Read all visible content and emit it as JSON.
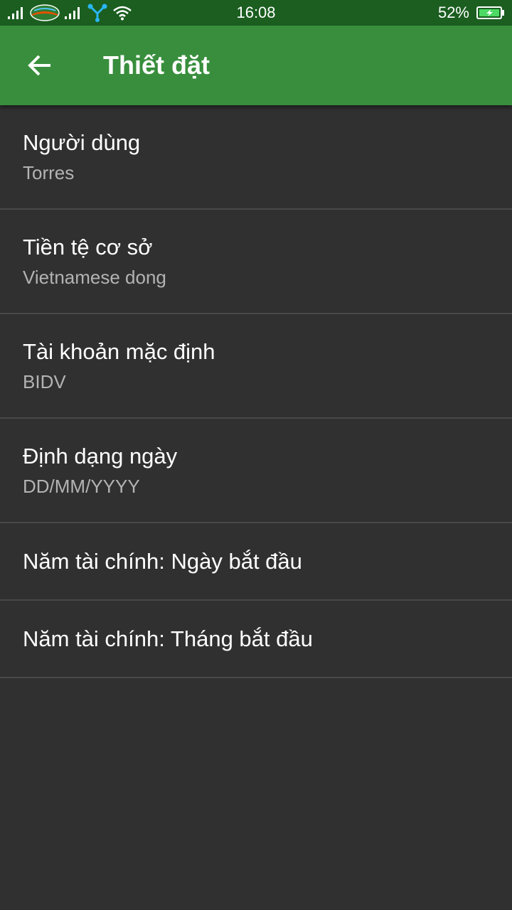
{
  "status_bar": {
    "time": "16:08",
    "battery_percent": "52%",
    "icons": [
      "signal-icon",
      "carrier-logo-icon",
      "signal-icon",
      "network-share-icon",
      "wifi-icon",
      "battery-charging-icon"
    ]
  },
  "app_bar": {
    "title": "Thiết đặt",
    "back_icon": "arrow-left-icon"
  },
  "settings": [
    {
      "title": "Người dùng",
      "summary": "Torres"
    },
    {
      "title": "Tiền tệ cơ sở",
      "summary": "Vietnamese dong"
    },
    {
      "title": "Tài khoản mặc định",
      "summary": "BIDV"
    },
    {
      "title": "Định dạng ngày",
      "summary": "DD/MM/YYYY"
    },
    {
      "title": "Năm tài chính: Ngày bắt đầu"
    },
    {
      "title": "Năm tài chính: Tháng bắt đầu"
    }
  ],
  "colors": {
    "status_bar": "#1b5e20",
    "app_bar": "#388e3c",
    "background": "#303030",
    "divider": "#484848",
    "summary_text": "#b3b3b3",
    "battery_fill": "#4cd964"
  }
}
